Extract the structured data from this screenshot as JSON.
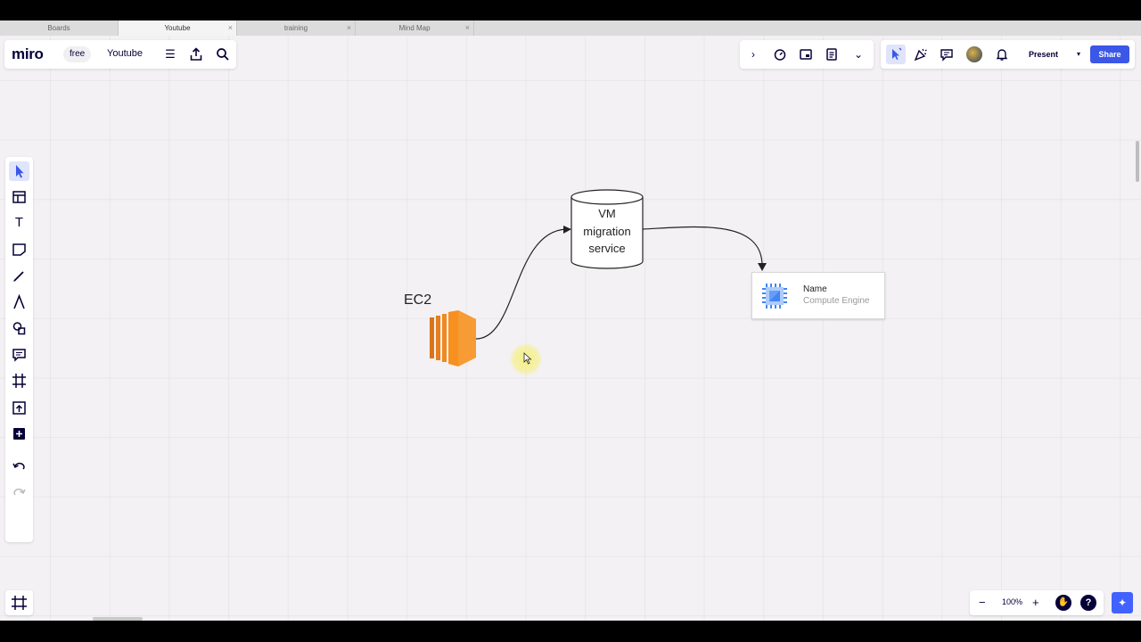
{
  "tabs": [
    {
      "label": "Boards",
      "active": false,
      "closable": false
    },
    {
      "label": "Youtube",
      "active": true,
      "closable": true
    },
    {
      "label": "training",
      "active": false,
      "closable": true
    },
    {
      "label": "Mind Map",
      "active": false,
      "closable": true
    }
  ],
  "header": {
    "logo": "miro",
    "plan": "free",
    "board_title": "Youtube"
  },
  "top_right": {
    "present_label": "Present",
    "share_label": "Share"
  },
  "toolbar": {
    "tools": [
      "select",
      "templates",
      "text",
      "sticky-note",
      "pen",
      "highlighter",
      "shapes",
      "comment",
      "frame",
      "upload",
      "more-apps",
      "undo",
      "redo"
    ]
  },
  "zoom": {
    "level": "100%",
    "minus": "−",
    "plus": "+"
  },
  "diagram": {
    "ec2_label": "EC2",
    "vm_lines": [
      "VM",
      "migration",
      "service"
    ],
    "card_name": "Name",
    "card_subtitle": "Compute Engine"
  },
  "colors": {
    "brand": "#050038",
    "accent": "#3a57e8",
    "share_button": "#3a57e8",
    "ec2_orange": "#f7901e",
    "compute_blue": "#4285f4"
  }
}
